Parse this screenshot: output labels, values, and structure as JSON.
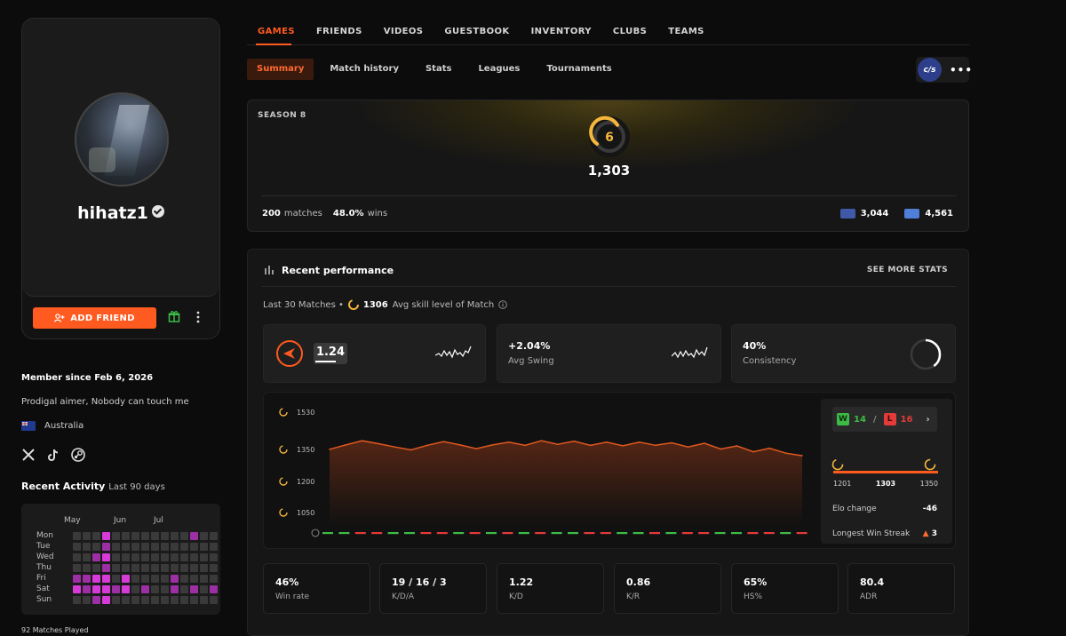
{
  "profile": {
    "username": "hihatz1",
    "add_friend_label": "ADD FRIEND",
    "member_since": "Member since Feb 6, 2026",
    "bio": "Prodigal aimer, Nobody can touch me",
    "country": "Australia"
  },
  "activity": {
    "title": "Recent Activity",
    "range": "Last 90 days",
    "months": [
      "May",
      "Jun",
      "Jul"
    ],
    "days": [
      "Mon",
      "Tue",
      "Wed",
      "Thu",
      "Fri",
      "Sat",
      "Sun"
    ],
    "grid": [
      [
        0,
        0,
        0,
        2,
        0,
        0,
        0,
        0,
        0,
        0,
        0,
        0,
        1,
        0,
        0
      ],
      [
        0,
        0,
        0,
        1,
        0,
        0,
        0,
        0,
        0,
        0,
        0,
        0,
        0,
        0,
        0
      ],
      [
        0,
        0,
        1,
        2,
        0,
        0,
        0,
        0,
        0,
        0,
        0,
        0,
        0,
        0,
        0
      ],
      [
        0,
        0,
        0,
        1,
        0,
        0,
        0,
        0,
        0,
        0,
        0,
        0,
        0,
        0,
        0
      ],
      [
        1,
        1,
        2,
        2,
        0,
        2,
        0,
        0,
        0,
        0,
        1,
        0,
        0,
        0,
        0
      ],
      [
        2,
        1,
        2,
        2,
        1,
        2,
        0,
        1,
        0,
        0,
        1,
        0,
        1,
        0,
        1
      ],
      [
        0,
        0,
        1,
        2,
        0,
        0,
        0,
        0,
        0,
        0,
        0,
        0,
        0,
        0,
        0
      ]
    ],
    "matches_played": "92 Matches Played"
  },
  "nav": {
    "tabs": [
      "GAMES",
      "FRIENDS",
      "VIDEOS",
      "GUESTBOOK",
      "INVENTORY",
      "CLUBS",
      "TEAMS"
    ],
    "subtabs": [
      "Summary",
      "Match history",
      "Stats",
      "Leagues",
      "Tournaments"
    ],
    "badge": "c/s"
  },
  "season": {
    "label": "SEASON 8",
    "level": "6",
    "elo": "1,303",
    "matches": "200",
    "matches_label": "matches",
    "winrate": "48.0%",
    "wins_label": "wins",
    "country_rank": "3,044",
    "region_rank": "4,561"
  },
  "performance": {
    "title": "Recent performance",
    "see_more": "SEE MORE STATS",
    "last30_label": "Last 30 Matches •",
    "avg_level": "1306",
    "avg_level_label": "Avg skill level of Match",
    "rating": "1.24",
    "avg_swing": "+2.04%",
    "avg_swing_label": "Avg Swing",
    "consistency": "40%",
    "consistency_label": "Consistency"
  },
  "chart_data": {
    "type": "line",
    "title": "",
    "y_ticks": [
      "1530",
      "1350",
      "1200",
      "1050"
    ],
    "ylim": [
      1050,
      1530
    ],
    "x": [
      1,
      2,
      3,
      4,
      5,
      6,
      7,
      8,
      9,
      10,
      11,
      12,
      13,
      14,
      15,
      16,
      17,
      18,
      19,
      20,
      21,
      22,
      23,
      24,
      25,
      26,
      27,
      28,
      29,
      30
    ],
    "values": [
      1351,
      1372,
      1392,
      1378,
      1362,
      1348,
      1370,
      1388,
      1372,
      1354,
      1372,
      1385,
      1370,
      1392,
      1375,
      1390,
      1370,
      1385,
      1368,
      1385,
      1370,
      1382,
      1362,
      1380,
      1352,
      1367,
      1339,
      1356,
      1332,
      1320
    ],
    "results": [
      "W",
      "W",
      "L",
      "L",
      "W",
      "W",
      "L",
      "L",
      "W",
      "L",
      "W",
      "L",
      "W",
      "L",
      "W",
      "W",
      "L",
      "L",
      "W",
      "W",
      "L",
      "W",
      "L",
      "L",
      "W",
      "W",
      "L",
      "L",
      "W",
      "L"
    ],
    "series": [
      {
        "name": "",
        "values": []
      }
    ],
    "grid": false
  },
  "wl": {
    "wins": "14",
    "losses": "16",
    "min_elo": "1201",
    "current_elo": "1303",
    "max_elo": "1350",
    "elo_change_label": "Elo change",
    "elo_change": "-46",
    "streak_label": "Longest Win Streak",
    "streak": "3"
  },
  "stats": [
    {
      "value": "46%",
      "label": "Win rate"
    },
    {
      "value": "19 / 16 / 3",
      "label": "K/D/A"
    },
    {
      "value": "1.22",
      "label": "K/D"
    },
    {
      "value": "0.86",
      "label": "K/R"
    },
    {
      "value": "65%",
      "label": "HS%"
    },
    {
      "value": "80.4",
      "label": "ADR"
    }
  ],
  "colors": {
    "accent": "#ff5a1f",
    "win": "#3dbb46",
    "loss": "#e33a3a",
    "heat_high": "#d63bd8",
    "heat_mid": "#9b2fa3"
  }
}
